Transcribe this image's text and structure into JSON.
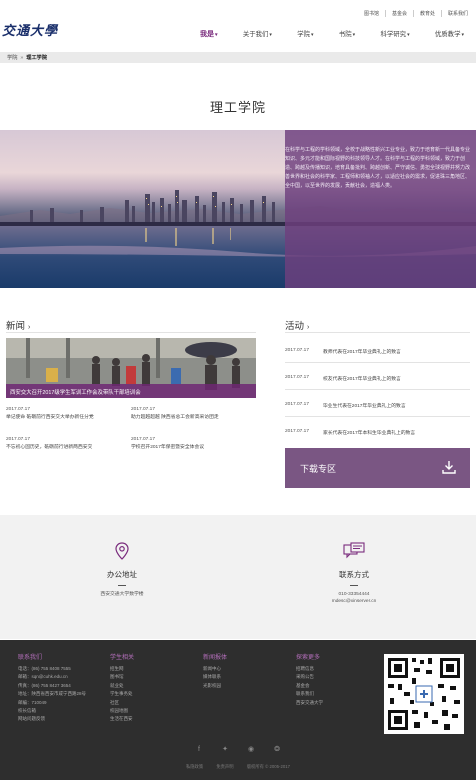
{
  "top_links": [
    "图书馆",
    "基金会",
    "教育处",
    "联系我们"
  ],
  "logo": "交通大學",
  "nav": [
    {
      "label": "我是",
      "active": true
    },
    {
      "label": "关于我们",
      "active": false
    },
    {
      "label": "学院",
      "active": false
    },
    {
      "label": "书院",
      "active": false
    },
    {
      "label": "科学研究",
      "active": false
    },
    {
      "label": "优质教学",
      "active": false
    }
  ],
  "breadcrumb": {
    "root": "学院",
    "sep": "»",
    "current": "理工学院"
  },
  "page_title": "理工学院",
  "banner_text": "在科学与工程的学科领域，全校于战略性新兴工业专业，致力于培育新一代具备专业知识、多元才能和国际视野的科技领导人才。在科学与工程的学科领域，致力于创造、跨越及传播知识，培育具备批判、跨越创新、严守诚信、勇担全球视野并努力改善世界和社会的科学家、工程师和领袖人才，以适应社会的需求，促进珠三角地区、全中国，以至世界的发展，贡献社会，造福人类。",
  "news": {
    "title": "新闻",
    "arrow": "›",
    "image_caption": "西安交大召开2017级学生军训工作会及带队干部培训会",
    "items": [
      {
        "date": "2017.07.17",
        "text": "举记使命 砥砺前行西安交大举办新任分党"
      },
      {
        "date": "2017.07.17",
        "text": "助力超越超越 陕西省总工会新高采访团走"
      },
      {
        "date": "2017.07.17",
        "text": "不忘初心固历史，砥砺前行进新两西安交"
      },
      {
        "date": "2017.07.17",
        "text": "学校召开2017年保密暨安全体会议"
      }
    ]
  },
  "activities": {
    "title": "活动",
    "arrow": "›",
    "items": [
      {
        "date": "2017.07.17",
        "text": "教师代表在2017年毕业典礼上的致言"
      },
      {
        "date": "2017.07.17",
        "text": "校友代表在2017年毕业典礼上的致言"
      },
      {
        "date": "2017.07.17",
        "text": "毕业生代表在2017年毕业典礼上的致言"
      },
      {
        "date": "2017.07.17",
        "text": "家长代表在2017年本科生毕业典礼上的致言"
      }
    ]
  },
  "download": {
    "label": "下载专区"
  },
  "contact": {
    "office": {
      "heading": "办公地址",
      "value": "西安交通大学数学楼"
    },
    "phone": {
      "heading": "联系方式",
      "value": "010-33354444",
      "email": "mdesc@xinserver.cn"
    }
  },
  "footer": {
    "cols": [
      {
        "heading": "联系我们",
        "lines": [
          "电话：(86) 755 8408 7555",
          "邮箱：sqn@cuhk.edu.cn",
          "传真：(86) 755 8427 3654",
          "地址：陕西省西安市咸宁西路28号",
          "邮编：710049",
          "校长信箱",
          "网站问题反馈"
        ]
      },
      {
        "heading": "学生相关",
        "lines": [
          "招生网",
          "图书馆",
          "就业处",
          "学生事务处",
          "社区",
          "校园地图",
          "生活在西安"
        ]
      },
      {
        "heading": "新闻报体",
        "lines": [
          "新闻中心",
          "媒体联系",
          "光影校园"
        ]
      },
      {
        "heading": "探索更多",
        "lines": [
          "招聘信息",
          "采购公告",
          "基金会",
          "联系我们",
          "西安交通大学"
        ]
      }
    ],
    "bottom_links": [
      "私隐政策",
      "免责声明",
      "版权所有 © 2005-2017"
    ]
  },
  "colors": {
    "brand": "#7a2c7d",
    "footer_bg": "#2e2e2e",
    "download_bg": "#7a5683"
  }
}
